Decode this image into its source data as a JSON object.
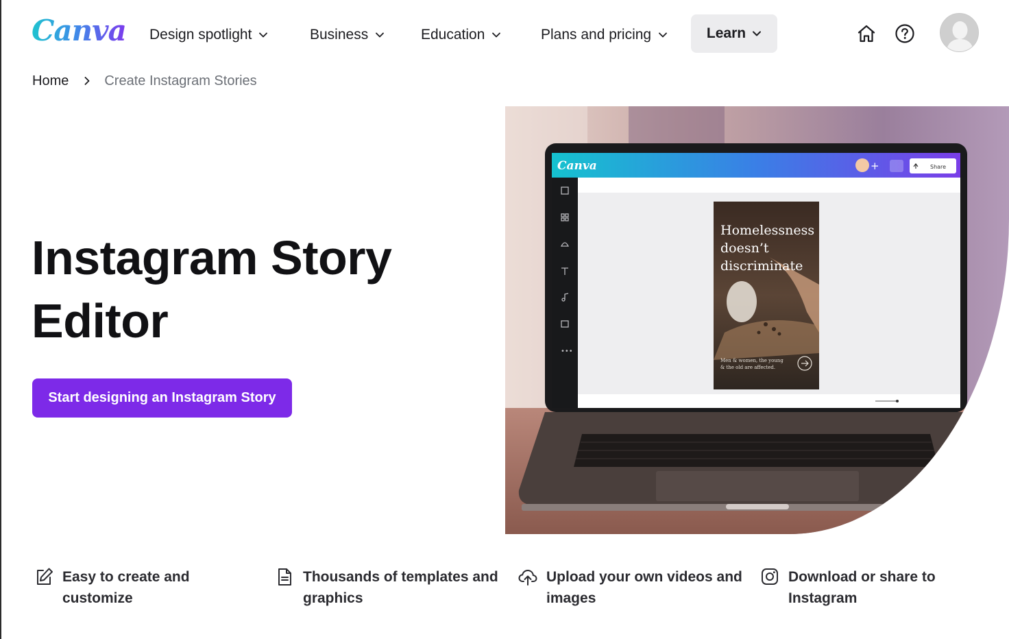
{
  "header": {
    "logo_text": "Canva",
    "nav": [
      {
        "label": "Design spotlight"
      },
      {
        "label": "Business"
      },
      {
        "label": "Education"
      },
      {
        "label": "Plans and pricing"
      },
      {
        "label": "Learn"
      }
    ],
    "icons": [
      "home-icon",
      "help-icon",
      "avatar"
    ]
  },
  "breadcrumb": {
    "home": "Home",
    "current": "Create Instagram Stories"
  },
  "hero": {
    "title_line1": "Instagram Story",
    "title_line2": "Editor",
    "cta_label": "Start designing an Instagram Story",
    "mockup": {
      "app_logo": "Canva",
      "share_label": "Share",
      "story_headline_1": "Homelessness",
      "story_headline_2": "doesn’t",
      "story_headline_3": "discriminate",
      "story_caption_1": "Men & women, the young",
      "story_caption_2": "& the old are affected."
    }
  },
  "features": [
    {
      "icon": "edit-icon",
      "line1": "Easy to create and",
      "line2": "customize"
    },
    {
      "icon": "document-icon",
      "line1": "Thousands of templates and",
      "line2": "graphics"
    },
    {
      "icon": "cloud-upload-icon",
      "line1": "Upload your own videos and",
      "line2": "images"
    },
    {
      "icon": "instagram-icon",
      "line1": "Download or share to",
      "line2": "Instagram"
    }
  ],
  "colors": {
    "accent": "#7d2ae8",
    "learn_bg": "#ececee",
    "muted_text": "#6b6f76"
  }
}
